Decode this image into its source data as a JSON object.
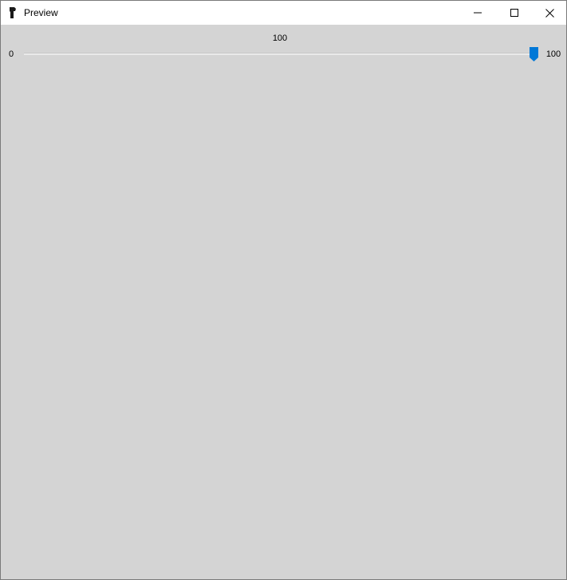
{
  "window": {
    "title": "Preview",
    "icon": "app-icon"
  },
  "caption_buttons": {
    "minimize": "minimize-icon",
    "maximize": "maximize-icon",
    "close": "close-icon"
  },
  "slider": {
    "value_label": "100",
    "min_label": "0",
    "max_label": "100",
    "min": 0,
    "max": 100,
    "value": 100
  },
  "colors": {
    "accent": "#0078d7",
    "viewport_background": "#d4d4d4"
  }
}
